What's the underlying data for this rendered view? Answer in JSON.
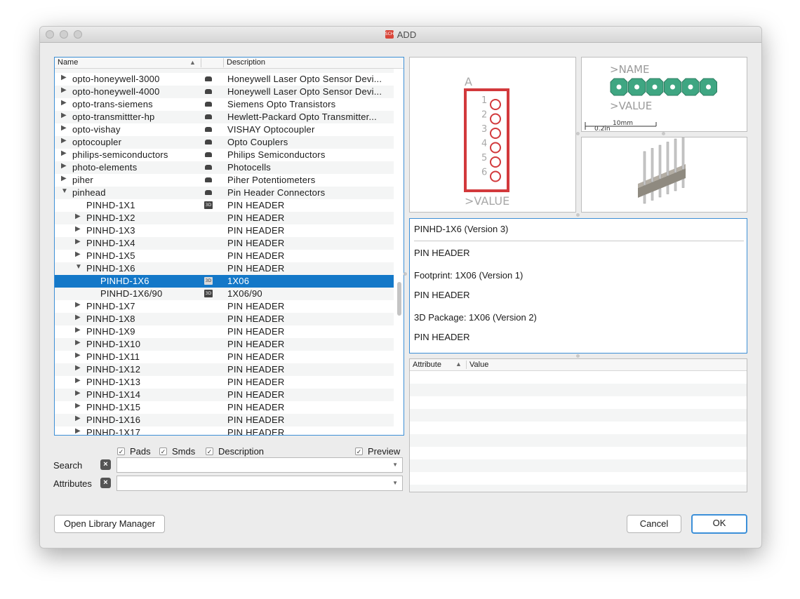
{
  "window": {
    "title": "ADD"
  },
  "tree": {
    "col_name": "Name",
    "col_desc": "Description",
    "rows": [
      {
        "name": "opto-honeywell-3000",
        "desc": "Honeywell Laser Opto Sensor Devi...",
        "indent": 0,
        "arrow": "right",
        "icon": "lib"
      },
      {
        "name": "opto-honeywell-4000",
        "desc": "Honeywell Laser Opto Sensor Devi...",
        "indent": 0,
        "arrow": "right",
        "icon": "lib"
      },
      {
        "name": "opto-trans-siemens",
        "desc": "Siemens Opto Transistors",
        "indent": 0,
        "arrow": "right",
        "icon": "lib"
      },
      {
        "name": "opto-transmittter-hp",
        "desc": "Hewlett-Packard Opto Transmitter...",
        "indent": 0,
        "arrow": "right",
        "icon": "lib"
      },
      {
        "name": "opto-vishay",
        "desc": "VISHAY Optocoupler",
        "indent": 0,
        "arrow": "right",
        "icon": "lib"
      },
      {
        "name": "optocoupler",
        "desc": "Opto Couplers",
        "indent": 0,
        "arrow": "right",
        "icon": "lib"
      },
      {
        "name": "philips-semiconductors",
        "desc": "Philips Semiconductors",
        "indent": 0,
        "arrow": "right",
        "icon": "lib"
      },
      {
        "name": "photo-elements",
        "desc": "Photocells",
        "indent": 0,
        "arrow": "right",
        "icon": "lib"
      },
      {
        "name": "piher",
        "desc": "Piher Potentiometers",
        "indent": 0,
        "arrow": "right",
        "icon": "lib"
      },
      {
        "name": "pinhead",
        "desc": "Pin Header Connectors",
        "indent": 0,
        "arrow": "down",
        "icon": "lib"
      },
      {
        "name": "PINHD-1X1",
        "desc": "PIN HEADER",
        "indent": 1,
        "arrow": "none",
        "icon": "3d"
      },
      {
        "name": "PINHD-1X2",
        "desc": "PIN HEADER",
        "indent": 1,
        "arrow": "right",
        "icon": "none"
      },
      {
        "name": "PINHD-1X3",
        "desc": "PIN HEADER",
        "indent": 1,
        "arrow": "right",
        "icon": "none"
      },
      {
        "name": "PINHD-1X4",
        "desc": "PIN HEADER",
        "indent": 1,
        "arrow": "right",
        "icon": "none"
      },
      {
        "name": "PINHD-1X5",
        "desc": "PIN HEADER",
        "indent": 1,
        "arrow": "right",
        "icon": "none"
      },
      {
        "name": "PINHD-1X6",
        "desc": "PIN HEADER",
        "indent": 1,
        "arrow": "down",
        "icon": "none"
      },
      {
        "name": "PINHD-1X6",
        "desc": "1X06",
        "indent": 2,
        "arrow": "none",
        "icon": "3d",
        "selected": true
      },
      {
        "name": "PINHD-1X6/90",
        "desc": "1X06/90",
        "indent": 2,
        "arrow": "none",
        "icon": "3d"
      },
      {
        "name": "PINHD-1X7",
        "desc": "PIN HEADER",
        "indent": 1,
        "arrow": "right",
        "icon": "none"
      },
      {
        "name": "PINHD-1X8",
        "desc": "PIN HEADER",
        "indent": 1,
        "arrow": "right",
        "icon": "none"
      },
      {
        "name": "PINHD-1X9",
        "desc": "PIN HEADER",
        "indent": 1,
        "arrow": "right",
        "icon": "none"
      },
      {
        "name": "PINHD-1X10",
        "desc": "PIN HEADER",
        "indent": 1,
        "arrow": "right",
        "icon": "none"
      },
      {
        "name": "PINHD-1X11",
        "desc": "PIN HEADER",
        "indent": 1,
        "arrow": "right",
        "icon": "none"
      },
      {
        "name": "PINHD-1X12",
        "desc": "PIN HEADER",
        "indent": 1,
        "arrow": "right",
        "icon": "none"
      },
      {
        "name": "PINHD-1X13",
        "desc": "PIN HEADER",
        "indent": 1,
        "arrow": "right",
        "icon": "none"
      },
      {
        "name": "PINHD-1X14",
        "desc": "PIN HEADER",
        "indent": 1,
        "arrow": "right",
        "icon": "none"
      },
      {
        "name": "PINHD-1X15",
        "desc": "PIN HEADER",
        "indent": 1,
        "arrow": "right",
        "icon": "none"
      },
      {
        "name": "PINHD-1X16",
        "desc": "PIN HEADER",
        "indent": 1,
        "arrow": "right",
        "icon": "none"
      },
      {
        "name": "PINHD-1X17",
        "desc": "PIN HEADER",
        "indent": 1,
        "arrow": "right",
        "icon": "none"
      }
    ]
  },
  "options": {
    "pads": "Pads",
    "smds": "Smds",
    "description": "Description",
    "preview": "Preview"
  },
  "search": {
    "label": "Search",
    "value": ""
  },
  "attributes": {
    "label": "Attributes",
    "value": ""
  },
  "preview": {
    "symbol_name": "A",
    "symbol_value": ">VALUE",
    "pins": [
      "1",
      "2",
      "3",
      "4",
      "5",
      "6"
    ],
    "footprint_name": ">NAME",
    "footprint_value": ">VALUE",
    "scale_top": "10mm",
    "scale_bottom": "0.2in"
  },
  "info": {
    "title": "PINHD-1X6 (Version 3)",
    "line1": "PIN HEADER",
    "footprint": "Footprint: 1X06 (Version 1)",
    "line2": "PIN HEADER",
    "package3d": "3D Package: 1X06 (Version 2)",
    "line3": "PIN HEADER"
  },
  "attr_table": {
    "col_attribute": "Attribute",
    "col_value": "Value"
  },
  "buttons": {
    "library_manager": "Open Library Manager",
    "cancel": "Cancel",
    "ok": "OK"
  },
  "colors": {
    "accent": "#1478c8",
    "symbol_red": "#d2393c",
    "pad_green": "#3fa682"
  }
}
